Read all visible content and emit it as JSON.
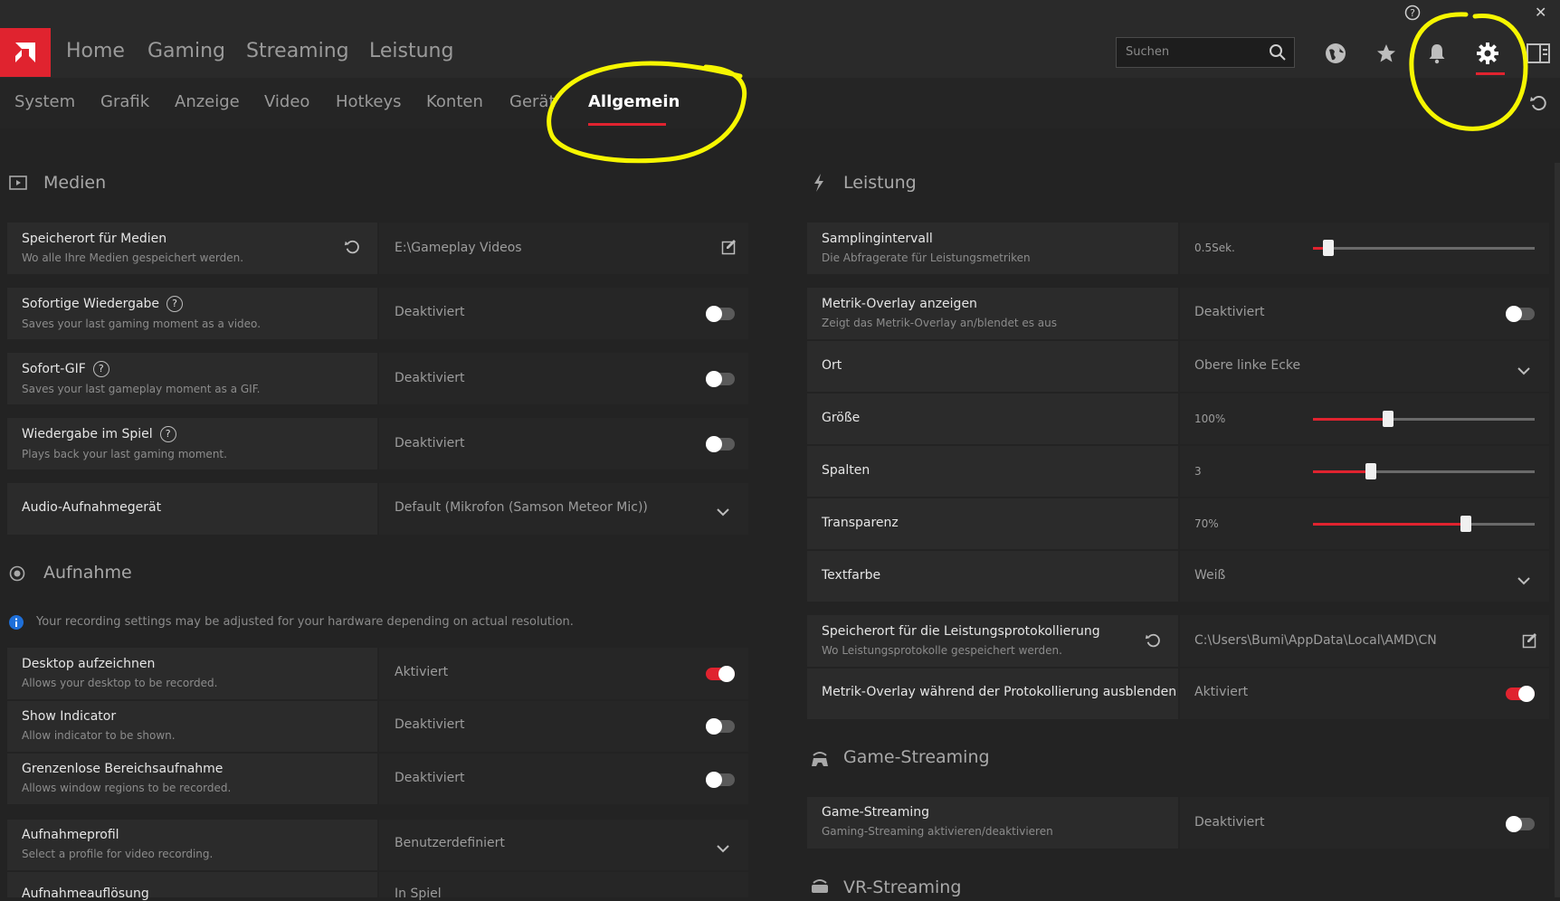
{
  "nav": {
    "items": [
      "Home",
      "Gaming",
      "Streaming",
      "Leistung"
    ],
    "search_placeholder": "Suchen",
    "window": {
      "help": "?",
      "close": "✕"
    }
  },
  "tabs": {
    "items": [
      "System",
      "Grafik",
      "Anzeige",
      "Video",
      "Hotkeys",
      "Konten",
      "Gerät",
      "Allgemein"
    ],
    "active": "Allgemein"
  },
  "medien": {
    "title": "Medien",
    "rows": [
      {
        "title": "Speicherort für Medien",
        "sub": "Wo alle Ihre Medien gespeichert werden.",
        "value": "E:\\Gameplay Videos"
      },
      {
        "title": "Sofortige Wiedergabe",
        "sub": "Saves your last gaming moment as a video.",
        "value": "Deaktiviert"
      },
      {
        "title": "Sofort-GIF",
        "sub": "Saves your last gameplay moment as a GIF.",
        "value": "Deaktiviert"
      },
      {
        "title": "Wiedergabe im Spiel",
        "sub": "Plays back your last gaming moment.",
        "value": "Deaktiviert"
      },
      {
        "title": "Audio-Aufnahmegerät",
        "sub": "",
        "value": "Default (Mikrofon (Samson Meteor Mic))"
      }
    ]
  },
  "aufnahme": {
    "title": "Aufnahme",
    "info": "Your recording settings may be adjusted for your hardware depending on actual resolution.",
    "rows": [
      {
        "title": "Desktop aufzeichnen",
        "sub": "Allows your desktop to be recorded.",
        "value": "Aktiviert",
        "on": true
      },
      {
        "title": "Show Indicator",
        "sub": "Allow indicator to be shown.",
        "value": "Deaktiviert",
        "on": false
      },
      {
        "title": "Grenzenlose Bereichsaufnahme",
        "sub": "Allows window regions to be recorded.",
        "value": "Deaktiviert",
        "on": false
      },
      {
        "title": "Aufnahmeprofil",
        "sub": "Select a profile for video recording.",
        "value": "Benutzerdefiniert"
      },
      {
        "title": "Aufnahmeauflösung",
        "sub": "",
        "value": "In Spiel"
      }
    ]
  },
  "leistung": {
    "title": "Leistung",
    "rows": [
      {
        "title": "Samplingintervall",
        "sub": "Die Abfragerate für Leistungsmetriken",
        "value": "0.5Sek.",
        "level": 0.07
      },
      {
        "title": "Metrik-Overlay anzeigen",
        "sub": "Zeigt das Metrik-Overlay an/blendet es aus",
        "value": "Deaktiviert",
        "on": false
      },
      {
        "title": "Ort",
        "sub": "",
        "value": "Obere linke Ecke"
      },
      {
        "title": "Größe",
        "sub": "",
        "value": "100%",
        "level": 0.34
      },
      {
        "title": "Spalten",
        "sub": "",
        "value": "3",
        "level": 0.26
      },
      {
        "title": "Transparenz",
        "sub": "",
        "value": "70%",
        "level": 0.69
      },
      {
        "title": "Textfarbe",
        "sub": "",
        "value": "Weiß"
      },
      {
        "title": "Speicherort für die Leistungsprotokollierung",
        "sub": "Wo Leistungsprotokolle gespeichert werden.",
        "value": "C:\\Users\\Bumi\\AppData\\Local\\AMD\\CN"
      },
      {
        "title": "Metrik-Overlay während der Protokollierung ausblenden",
        "sub": "",
        "value": "Aktiviert",
        "on": true
      }
    ]
  },
  "game_streaming": {
    "title": "Game-Streaming",
    "rows": [
      {
        "title": "Game-Streaming",
        "sub": "Gaming-Streaming aktivieren/deaktivieren",
        "value": "Deaktiviert",
        "on": false
      }
    ]
  },
  "vr_streaming": {
    "title": "VR-Streaming"
  },
  "colors": {
    "accent": "#e0232f",
    "annotation": "#f6f600"
  }
}
